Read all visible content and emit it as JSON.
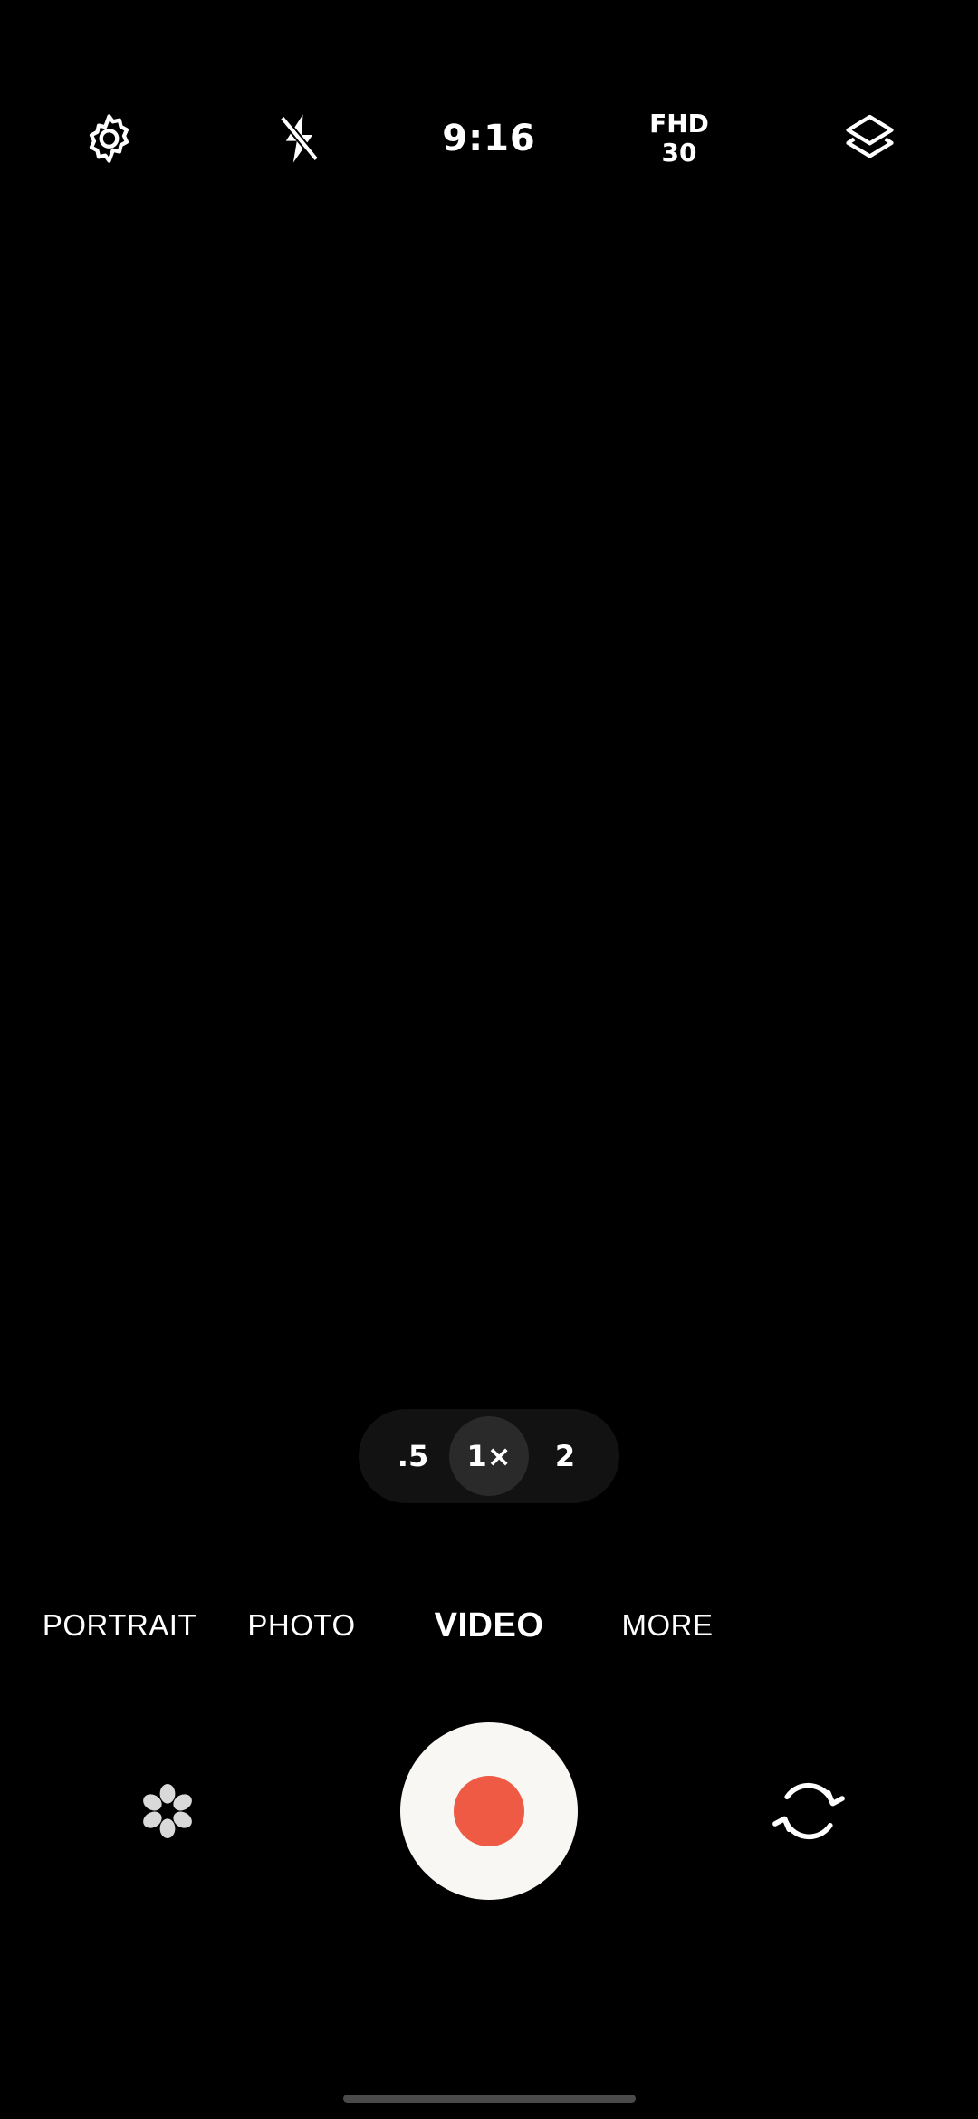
{
  "top_bar": {
    "settings_icon": "gear-icon",
    "flash_icon": "flash-off-icon",
    "timer": "9:16",
    "resolution_line1": "FHD",
    "resolution_line2": "30",
    "layers_icon": "layers-icon"
  },
  "zoom": {
    "options": [
      ".5",
      "1×",
      "2"
    ],
    "selected": "1×"
  },
  "modes": {
    "items": [
      "PORTRAIT",
      "PHOTO",
      "VIDEO",
      "MORE"
    ],
    "selected": "VIDEO"
  },
  "controls": {
    "left_icon": "filter-flower-icon",
    "shutter_icon": "record-icon",
    "right_icon": "switch-camera-icon"
  },
  "colors": {
    "record": "#ef5a45",
    "shutter_bg": "#f8f7f3",
    "background": "#000000"
  }
}
